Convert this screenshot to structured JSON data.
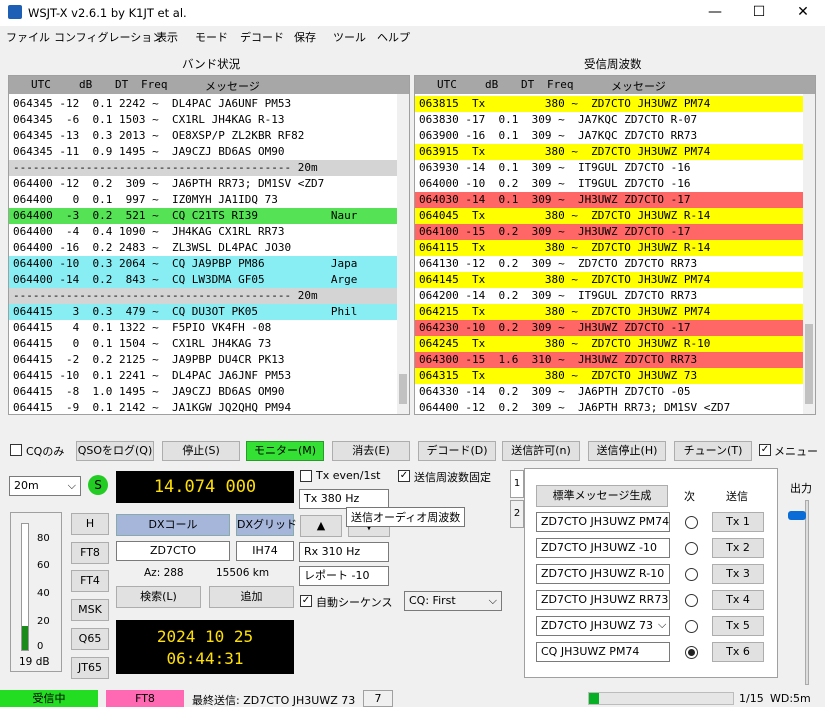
{
  "app": {
    "title": "WSJT-X  v2.6.1  by K1JT et al.",
    "min": "—",
    "max": "☐",
    "close": "✕"
  },
  "menu": [
    "ファイル",
    "コンフィグレーション",
    "表示",
    "モード",
    "デコード",
    "保存",
    "ツール",
    "ヘルプ"
  ],
  "band_activity": {
    "title": "バンド状況",
    "headers": {
      "utc": "UTC",
      "db": "dB",
      "dt": "DT",
      "freq": "Freq",
      "msg": "メッセージ"
    },
    "rows": [
      {
        "text": "064345 -12  0.1 2242 ~  DL4PAC JA6UNF PM53",
        "bg": "#ffffff"
      },
      {
        "text": "064345  -6  0.1 1503 ~  CX1RL JH4KAG R-13",
        "bg": "#ffffff"
      },
      {
        "text": "064345 -13  0.3 2013 ~  OE8XSP/P ZL2KBR RF82",
        "bg": "#ffffff"
      },
      {
        "text": "064345 -11  0.9 1495 ~  JA9CZJ BD6AS OM90",
        "bg": "#ffffff"
      },
      {
        "text": "------------------------------------------ 20m",
        "bg": "#d4d4d4"
      },
      {
        "text": "064400 -12  0.2  309 ~  JA6PTH RR73; DM1SV <ZD7",
        "bg": "#ffffff"
      },
      {
        "text": "064400   0  0.1  997 ~  IZ0MYH JA1IDQ 73",
        "bg": "#ffffff"
      },
      {
        "text": "064400  -3  0.2  521 ~  CQ C21TS RI39           Naur",
        "bg": "#55e255"
      },
      {
        "text": "064400  -4  0.4 1090 ~  JH4KAG CX1RL RR73",
        "bg": "#ffffff"
      },
      {
        "text": "064400 -16  0.2 2483 ~  ZL3WSL DL4PAC JO30",
        "bg": "#ffffff"
      },
      {
        "text": "064400 -10  0.3 2064 ~  CQ JA9PBP PM86          Japa",
        "bg": "#88eef4"
      },
      {
        "text": "064400 -14  0.2  843 ~  CQ LW3DMA GF05          Arge",
        "bg": "#88eef4"
      },
      {
        "text": "------------------------------------------ 20m",
        "bg": "#d4d4d4"
      },
      {
        "text": "064415   3  0.3  479 ~  CQ DU3OT PK05           Phil",
        "bg": "#88eef4"
      },
      {
        "text": "064415   4  0.1 1322 ~  F5PIO VK4FH -08",
        "bg": "#ffffff"
      },
      {
        "text": "064415   0  0.1 1504 ~  CX1RL JH4KAG 73",
        "bg": "#ffffff"
      },
      {
        "text": "064415  -2  0.2 2125 ~  JA9PBP DU4CR PK13",
        "bg": "#ffffff"
      },
      {
        "text": "064415 -10  0.1 2241 ~  DL4PAC JA6JNF PM53",
        "bg": "#ffffff"
      },
      {
        "text": "064415  -8  1.0 1495 ~  JA9CZJ BD6AS OM90",
        "bg": "#ffffff"
      },
      {
        "text": "064415  -9  0.1 2142 ~  JA1KGW JQ2QHQ PM94",
        "bg": "#ffffff"
      }
    ]
  },
  "rx_frequency": {
    "title": "受信周波数",
    "headers": {
      "utc": "UTC",
      "db": "dB",
      "dt": "DT",
      "freq": "Freq",
      "msg": "メッセージ"
    },
    "rows": [
      {
        "text": "063815  Tx         380 ~  ZD7CTO JH3UWZ PM74",
        "bg": "#ffff00"
      },
      {
        "text": "063830 -17  0.1  309 ~  JA7KQC ZD7CTO R-07",
        "bg": "#ffffff"
      },
      {
        "text": "063900 -16  0.1  309 ~  JA7KQC ZD7CTO RR73",
        "bg": "#ffffff"
      },
      {
        "text": "063915  Tx         380 ~  ZD7CTO JH3UWZ PM74",
        "bg": "#ffff00"
      },
      {
        "text": "063930 -14  0.1  309 ~  IT9GUL ZD7CTO -16",
        "bg": "#ffffff"
      },
      {
        "text": "064000 -10  0.2  309 ~  IT9GUL ZD7CTO -16",
        "bg": "#ffffff"
      },
      {
        "text": "064030 -14  0.1  309 ~  JH3UWZ ZD7CTO -17",
        "bg": "#ff6666"
      },
      {
        "text": "064045  Tx         380 ~  ZD7CTO JH3UWZ R-14",
        "bg": "#ffff00"
      },
      {
        "text": "064100 -15  0.2  309 ~  JH3UWZ ZD7CTO -17",
        "bg": "#ff6666"
      },
      {
        "text": "064115  Tx         380 ~  ZD7CTO JH3UWZ R-14",
        "bg": "#ffff00"
      },
      {
        "text": "064130 -12  0.2  309 ~  ZD7CTO ZD7CTO RR73",
        "bg": "#ffffff"
      },
      {
        "text": "064145  Tx         380 ~  ZD7CTO JH3UWZ PM74",
        "bg": "#ffff00"
      },
      {
        "text": "064200 -14  0.2  309 ~  IT9GUL ZD7CTO RR73",
        "bg": "#ffffff"
      },
      {
        "text": "064215  Tx         380 ~  ZD7CTO JH3UWZ PM74",
        "bg": "#ffff00"
      },
      {
        "text": "064230 -10  0.2  309 ~  JH3UWZ ZD7CTO -17",
        "bg": "#ff6666"
      },
      {
        "text": "064245  Tx         380 ~  ZD7CTO JH3UWZ R-10",
        "bg": "#ffff00"
      },
      {
        "text": "064300 -15  1.6  310 ~  JH3UWZ ZD7CTO RR73",
        "bg": "#ff6666"
      },
      {
        "text": "064315  Tx         380 ~  ZD7CTO JH3UWZ 73",
        "bg": "#ffff00"
      },
      {
        "text": "064330 -14  0.2  309 ~  JA6PTH ZD7CTO -05",
        "bg": "#ffffff"
      },
      {
        "text": "064400 -12  0.2  309 ~  JA6PTH RR73; DM1SV <ZD7",
        "bg": "#ffffff"
      }
    ]
  },
  "controls": {
    "cq_only": "CQのみ",
    "log_qso": "QSOをログ(Q)",
    "stop": "停止(S)",
    "monitor": "モニター(M)",
    "erase": "消去(E)",
    "decode": "デコード(D)",
    "enable_tx": "送信許可(n)",
    "halt_tx": "送信停止(H)",
    "tune": "チューン(T)",
    "menus": "メニュー"
  },
  "left": {
    "band": "20m",
    "s_label": "S",
    "frequency": "14.074 000",
    "dx_call_btn": "DXコール",
    "dx_grid_btn": "DXグリッド",
    "dx_call": "ZD7CTO",
    "dx_grid": "IH74",
    "az": "Az: 288",
    "dist": "15506 km",
    "lookup": "検索(L)",
    "add": "追加",
    "date": "2024 10 25",
    "time": "06:44:31",
    "db_reading": "19 dB",
    "meter_ticks": [
      "80",
      "60",
      "40",
      "20",
      "0"
    ],
    "meter_level": 0.19,
    "modes": [
      "H",
      "FT8",
      "FT4",
      "MSK",
      "Q65",
      "JT65"
    ]
  },
  "mid": {
    "tx_even": "Tx even/1st",
    "hold_tx": "送信周波数固定",
    "tx_hz": "Tx  380  Hz",
    "tooltip": "送信オーディオ周波数",
    "rx_hz": "Rx  310  Hz",
    "report": "レポート -10",
    "auto_seq": "自動シーケンス",
    "cq_select": "CQ: First",
    "up_arrow": "▲",
    "down_arrow": "▼"
  },
  "tabs": {
    "tab1": "1",
    "tab2": "2"
  },
  "messages": {
    "gen_std": "標準メッセージ生成",
    "next": "次",
    "send": "送信",
    "list": [
      {
        "text": "ZD7CTO JH3UWZ PM74",
        "tx": "Tx 1"
      },
      {
        "text": "ZD7CTO JH3UWZ -10",
        "tx": "Tx 2"
      },
      {
        "text": "ZD7CTO JH3UWZ R-10",
        "tx": "Tx 3"
      },
      {
        "text": "ZD7CTO JH3UWZ RR73",
        "tx": "Tx 4"
      },
      {
        "text": "ZD7CTO JH3UWZ 73",
        "tx": "Tx 5"
      },
      {
        "text": "CQ JH3UWZ PM74",
        "tx": "Tx 6"
      }
    ]
  },
  "power_label": "出力",
  "status": {
    "receiving": "受信中",
    "mode": "FT8",
    "last_tx": "最終送信: ZD7CTO JH3UWZ 73",
    "count": "7",
    "progress": "1/15",
    "wd": "WD:5m"
  }
}
